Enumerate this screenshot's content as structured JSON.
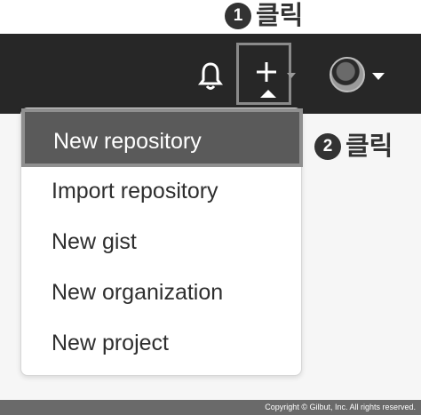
{
  "annotations": {
    "step1": {
      "number": "1",
      "text": "클릭"
    },
    "step2": {
      "number": "2",
      "text": "클릭"
    }
  },
  "header": {
    "icons": [
      "bell-icon",
      "plus-icon",
      "avatar",
      "chevron-down-icon"
    ]
  },
  "dropdown": {
    "items": [
      {
        "label": "New repository",
        "active": true
      },
      {
        "label": "Import repository"
      },
      {
        "label": "New gist"
      },
      {
        "label": "New organization"
      },
      {
        "label": "New project"
      }
    ]
  },
  "footer": {
    "copyright": "Copyright © Gilbut, Inc. All rights reserved."
  }
}
